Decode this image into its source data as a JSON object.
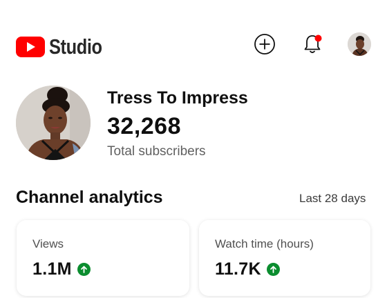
{
  "app": {
    "logo_text": "Studio",
    "brand_color": "#ff0000",
    "notification_dot_color": "#ff0000"
  },
  "header": {
    "icons": [
      "create-icon",
      "notifications-icon",
      "account-avatar"
    ]
  },
  "channel": {
    "name": "Tress To Impress",
    "subscriber_count": "32,268",
    "subscriber_label": "Total subscribers"
  },
  "analytics": {
    "title": "Channel analytics",
    "period": "Last 28 days",
    "cards": [
      {
        "label": "Views",
        "value": "1.1M",
        "trend": "up"
      },
      {
        "label": "Watch time (hours)",
        "value": "11.7K",
        "trend": "up"
      }
    ],
    "trend_up_color": "#0b8d2f"
  }
}
